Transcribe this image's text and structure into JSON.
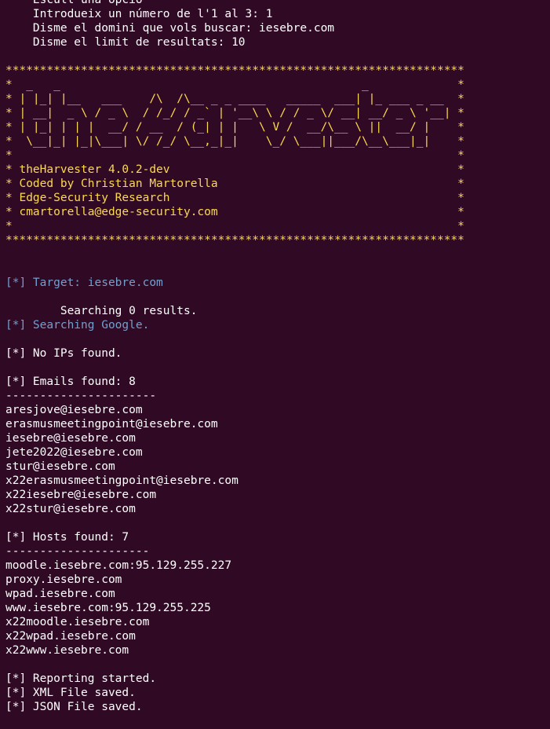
{
  "colors": {
    "background": "#300a24",
    "text": "#ffffff",
    "banner_yellow": "#fcd94f",
    "info_blue": "#739fcf"
  },
  "terminal": {
    "lines": [
      {
        "text": "    Escull una opció",
        "color": "white"
      },
      {
        "text": "    Introdueix un número de l'1 al 3: 1",
        "color": "white"
      },
      {
        "text": "    Disme el domini que vols buscar: iesebre.com",
        "color": "white"
      },
      {
        "text": "    Disme el limit de resultats: 10",
        "color": "white"
      },
      {
        "text": "",
        "color": "white"
      },
      {
        "text": "*******************************************************************",
        "color": "yellow"
      },
      {
        "text": "*  _   _                                            _             *",
        "color": "yellow"
      },
      {
        "text": "* | |_| |__   ___    /\\  /\\__ _ _ ____   _____  ___| |_ ___ _ __  *",
        "color": "yellow"
      },
      {
        "text": "* | __|  _ \\ / _ \\  / /_/ / _` | '__\\ \\ / / _ \\/ __| __/ _ \\ '__| *",
        "color": "yellow"
      },
      {
        "text": "* | |_| | | |  __/ / __  / (_| | |   \\ V /  __/\\__ \\ ||  __/ |    *",
        "color": "yellow"
      },
      {
        "text": "*  \\__|_| |_|\\___| \\/ /_/ \\__,_|_|    \\_/ \\___||___/\\__\\___|_|    *",
        "color": "yellow"
      },
      {
        "text": "*                                                                 *",
        "color": "yellow"
      },
      {
        "text": "* theHarvester 4.0.2-dev                                          *",
        "color": "yellow"
      },
      {
        "text": "* Coded by Christian Martorella                                   *",
        "color": "yellow"
      },
      {
        "text": "* Edge-Security Research                                          *",
        "color": "yellow"
      },
      {
        "text": "* cmartorella@edge-security.com                                   *",
        "color": "yellow"
      },
      {
        "text": "*                                                                 *",
        "color": "yellow"
      },
      {
        "text": "*******************************************************************",
        "color": "yellow"
      },
      {
        "text": "",
        "color": "white"
      },
      {
        "text": "",
        "color": "white"
      },
      {
        "text": "[*] Target: iesebre.com",
        "color": "blue"
      },
      {
        "text": "",
        "color": "white"
      },
      {
        "text": "        Searching 0 results.",
        "color": "white"
      },
      {
        "text": "[*] Searching Google.",
        "color": "blue"
      },
      {
        "text": "",
        "color": "white"
      },
      {
        "text": "[*] No IPs found.",
        "color": "white"
      },
      {
        "text": "",
        "color": "white"
      },
      {
        "text": "[*] Emails found: 8",
        "color": "white"
      },
      {
        "text": "----------------------",
        "color": "white"
      },
      {
        "text": "aresjove@iesebre.com",
        "color": "white"
      },
      {
        "text": "erasmusmeetingpoint@iesebre.com",
        "color": "white"
      },
      {
        "text": "iesebre@iesebre.com",
        "color": "white"
      },
      {
        "text": "jete2022@iesebre.com",
        "color": "white"
      },
      {
        "text": "stur@iesebre.com",
        "color": "white"
      },
      {
        "text": "x22erasmusmeetingpoint@iesebre.com",
        "color": "white"
      },
      {
        "text": "x22iesebre@iesebre.com",
        "color": "white"
      },
      {
        "text": "x22stur@iesebre.com",
        "color": "white"
      },
      {
        "text": "",
        "color": "white"
      },
      {
        "text": "[*] Hosts found: 7",
        "color": "white"
      },
      {
        "text": "---------------------",
        "color": "white"
      },
      {
        "text": "moodle.iesebre.com:95.129.255.227",
        "color": "white"
      },
      {
        "text": "proxy.iesebre.com",
        "color": "white"
      },
      {
        "text": "wpad.iesebre.com",
        "color": "white"
      },
      {
        "text": "www.iesebre.com:95.129.255.225",
        "color": "white"
      },
      {
        "text": "x22moodle.iesebre.com",
        "color": "white"
      },
      {
        "text": "x22wpad.iesebre.com",
        "color": "white"
      },
      {
        "text": "x22www.iesebre.com",
        "color": "white"
      },
      {
        "text": "",
        "color": "white"
      },
      {
        "text": "[*] Reporting started.",
        "color": "white"
      },
      {
        "text": "[*] XML File saved.",
        "color": "white"
      },
      {
        "text": "[*] JSON File saved.",
        "color": "white"
      }
    ]
  }
}
